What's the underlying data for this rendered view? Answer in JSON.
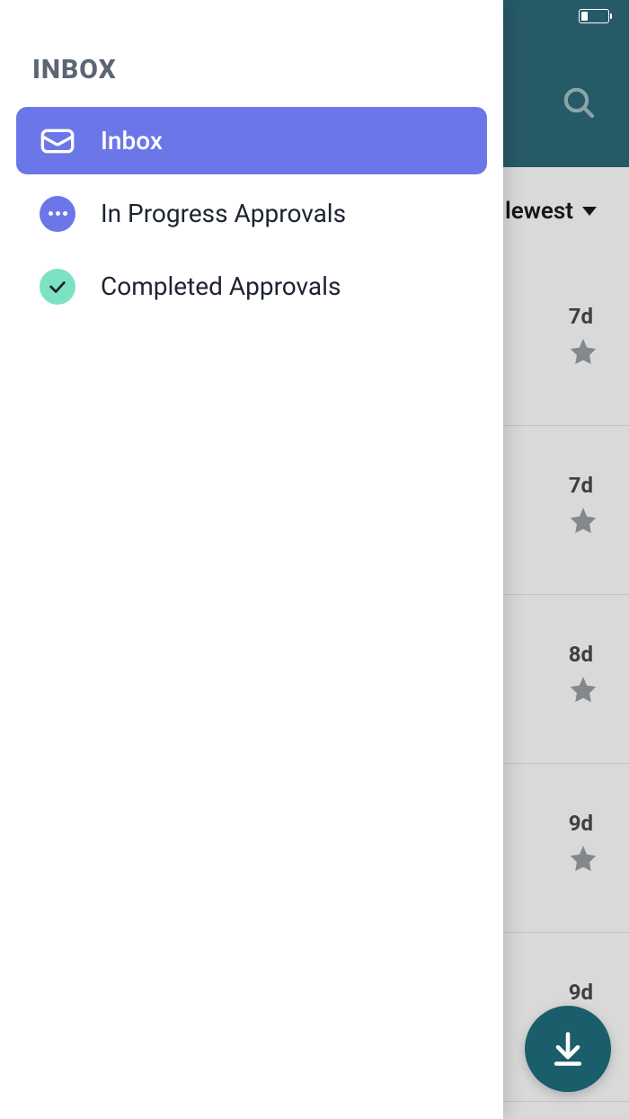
{
  "drawer": {
    "title": "INBOX",
    "items": [
      {
        "label": "Inbox",
        "icon": "envelope-icon",
        "active": true
      },
      {
        "label": "In Progress Approvals",
        "icon": "dots-icon",
        "active": false
      },
      {
        "label": "Completed Approvals",
        "icon": "check-icon",
        "active": false
      }
    ]
  },
  "header": {
    "search_icon": "search-icon"
  },
  "sort": {
    "label": "lewest"
  },
  "list": {
    "items": [
      {
        "age": "7d"
      },
      {
        "age": "7d"
      },
      {
        "age": "8d"
      },
      {
        "age": "9d"
      },
      {
        "age": "9d"
      }
    ]
  },
  "fab": {
    "icon": "download-icon"
  },
  "status": {
    "battery_percent": 25
  }
}
